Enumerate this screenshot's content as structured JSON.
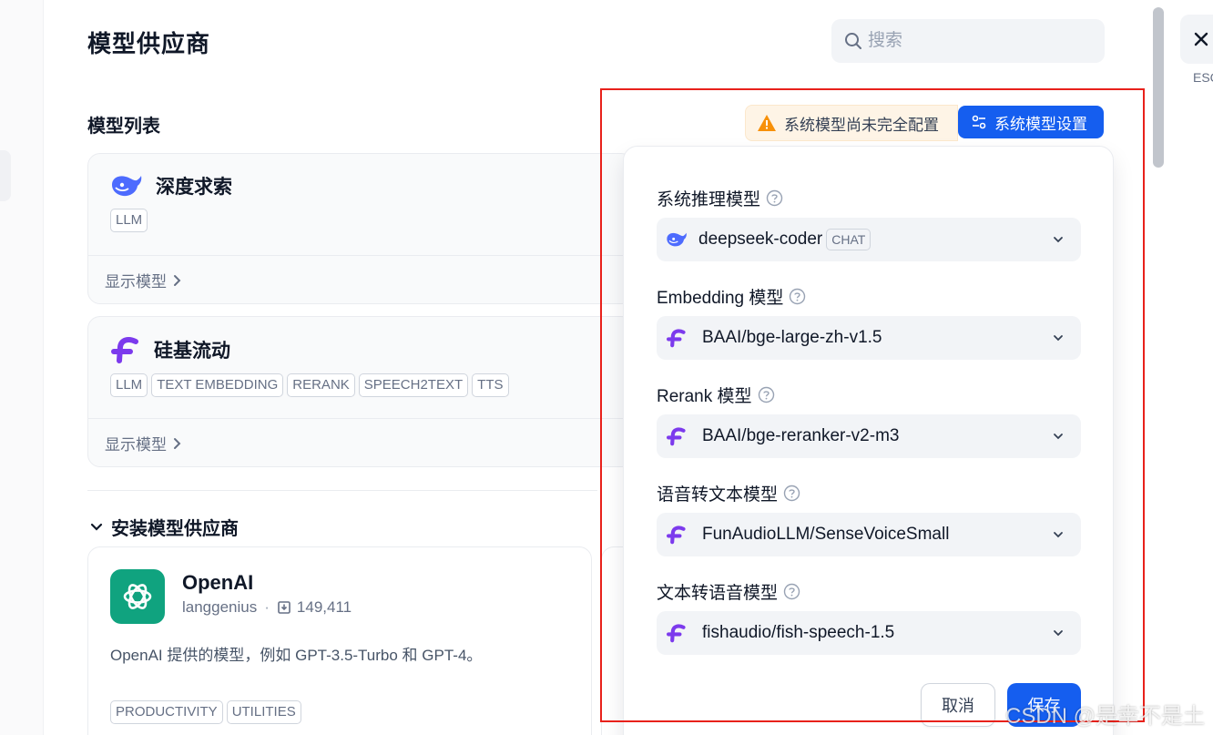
{
  "page": {
    "title": "模型供应商"
  },
  "search": {
    "placeholder": "搜索"
  },
  "model_list": {
    "title": "模型列表"
  },
  "status": {
    "warning_text": "系统模型尚未完全配置",
    "settings_button": "系统模型设置"
  },
  "providers": [
    {
      "name": "深度求索",
      "tags": [
        "LLM"
      ],
      "show_models": "显示模型"
    },
    {
      "name": "硅基流动",
      "tags": [
        "LLM",
        "TEXT EMBEDDING",
        "RERANK",
        "SPEECH2TEXT",
        "TTS"
      ],
      "show_models": "显示模型"
    }
  ],
  "install": {
    "title": "安装模型供应商",
    "openai": {
      "name": "OpenAI",
      "author": "langgenius",
      "installs": "149,411",
      "description": "OpenAI 提供的模型，例如 GPT-3.5-Turbo 和 GPT-4。",
      "tags": [
        "PRODUCTIVITY",
        "UTILITIES"
      ]
    }
  },
  "system_model_panel": {
    "fields": [
      {
        "label": "系统推理模型",
        "value": "deepseek-coder",
        "badge": "CHAT",
        "icon": "deepseek-whale-icon"
      },
      {
        "label": "Embedding 模型",
        "value": "BAAI/bge-large-zh-v1.5",
        "icon": "siliconflow-icon"
      },
      {
        "label": "Rerank 模型",
        "value": "BAAI/bge-reranker-v2-m3",
        "icon": "siliconflow-icon"
      },
      {
        "label": "语音转文本模型",
        "value": "FunAudioLLM/SenseVoiceSmall",
        "icon": "siliconflow-icon"
      },
      {
        "label": "文本转语音模型",
        "value": "fishaudio/fish-speech-1.5",
        "icon": "siliconflow-icon"
      }
    ],
    "cancel": "取消",
    "save": "保存"
  },
  "close": {
    "esc_label": "ESC"
  },
  "watermark": "CSDN @是幸不是土",
  "colors": {
    "primary": "#155eef",
    "warning_bg": "#fef4e6",
    "warning_icon": "#f79009",
    "deepseek": "#4d6bfe",
    "siliconflow": "#7c3aed",
    "openai": "#10a37f",
    "annotation_frame": "#e8211b"
  }
}
